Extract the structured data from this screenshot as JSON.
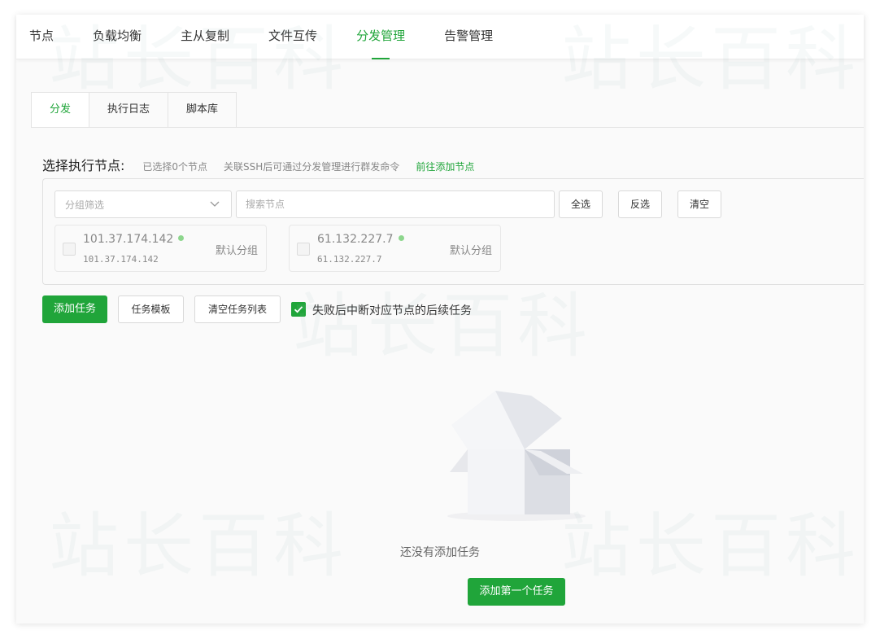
{
  "top_nav": {
    "items": [
      "节点",
      "负载均衡",
      "主从复制",
      "文件互传",
      "分发管理",
      "告警管理"
    ],
    "active": "分发管理"
  },
  "sub_tabs": {
    "items": [
      "分发",
      "执行日志",
      "脚本库"
    ],
    "active": "分发"
  },
  "node_select": {
    "title": "选择执行节点:",
    "selected_info": "已选择0个节点",
    "hint": "关联SSH后可通过分发管理进行群发命令",
    "add_link": "前往添加节点",
    "group_filter_placeholder": "分组筛选",
    "search_placeholder": "搜索节点",
    "select_all": "全选",
    "invert": "反选",
    "clear": "清空",
    "nodes": [
      {
        "ip": "101.37.174.142",
        "sub": "101.37.174.142",
        "group": "默认分组",
        "status_color": "#8dd68d"
      },
      {
        "ip": "61.132.227.7",
        "sub": "61.132.227.7",
        "group": "默认分组",
        "status_color": "#8dd68d"
      }
    ]
  },
  "actions": {
    "add_task": "添加任务",
    "task_template": "任务模板",
    "clear_tasks": "清空任务列表",
    "stop_on_fail_label": "失败后中断对应节点的后续任务",
    "stop_on_fail_checked": true
  },
  "empty": {
    "text": "还没有添加任务",
    "button": "添加第一个任务"
  },
  "watermark": "站长百科",
  "colors": {
    "accent": "#20a53a",
    "online": "#8dd68d"
  }
}
